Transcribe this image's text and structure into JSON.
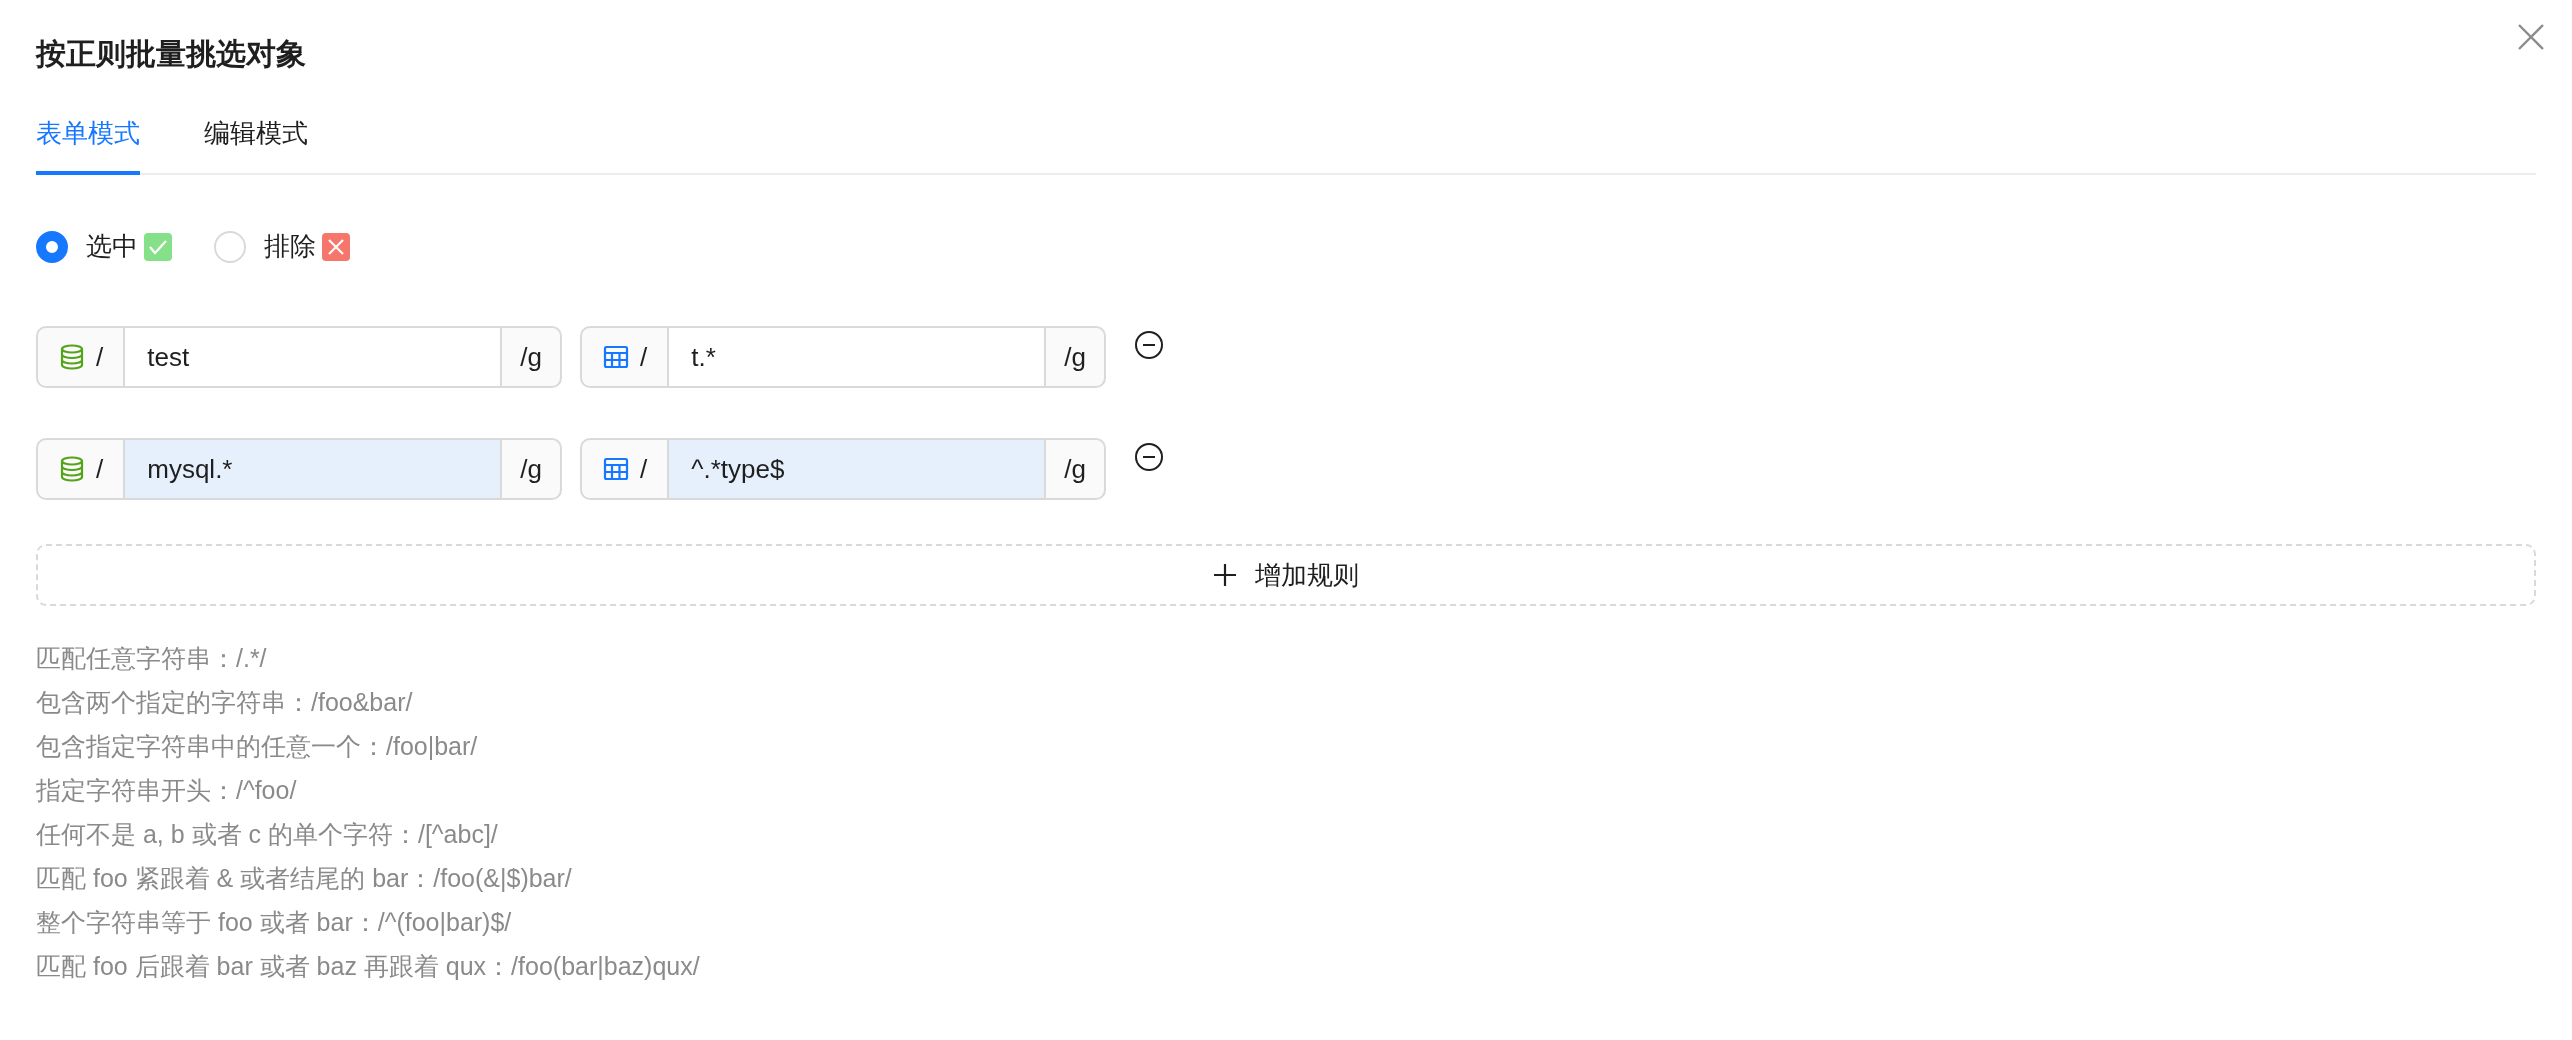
{
  "dialog": {
    "title": "按正则批量挑选对象"
  },
  "tabs": [
    {
      "label": "表单模式",
      "selected": true
    },
    {
      "label": "编辑模式",
      "selected": false
    }
  ],
  "mode_options": [
    {
      "label": "选中",
      "kind": "include",
      "selected": true
    },
    {
      "label": "排除",
      "kind": "exclude",
      "selected": false
    }
  ],
  "rules": [
    {
      "highlighted": false,
      "database": {
        "prefix": "/",
        "value": "test",
        "suffix": "/g"
      },
      "table": {
        "prefix": "/",
        "value": "t.*",
        "suffix": "/g"
      }
    },
    {
      "highlighted": true,
      "database": {
        "prefix": "/",
        "value": "mysql.*",
        "suffix": "/g"
      },
      "table": {
        "prefix": "/",
        "value": "^.*type$",
        "suffix": "/g"
      }
    }
  ],
  "add_rule_button": "增加规则",
  "help_lines": [
    "匹配任意字符串：/.*/",
    "包含两个指定的字符串：/foo&bar/",
    "包含指定字符串中的任意一个：/foo|bar/",
    "指定字符串开头：/^foo/",
    "任何不是 a, b 或者 c 的单个字符：/[^abc]/",
    "匹配 foo 紧跟着 & 或者结尾的 bar：/foo(&|$)bar/",
    "整个字符串等于 foo 或者 bar：/^(foo|bar)$/",
    "匹配 foo 后跟着 bar 或者 baz 再跟着 qux：/foo(bar|baz)qux/"
  ]
}
